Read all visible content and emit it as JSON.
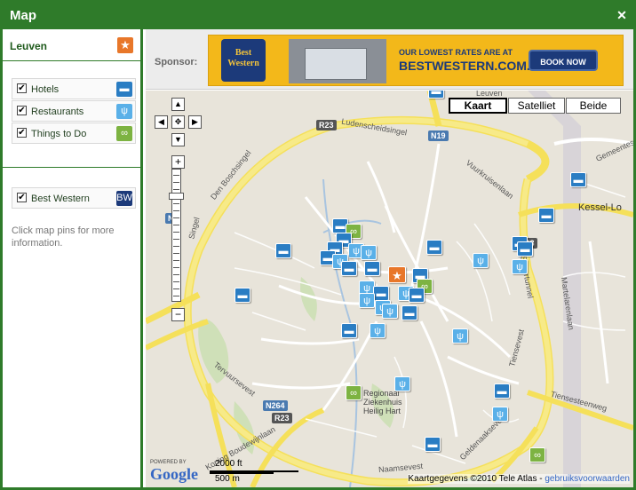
{
  "window": {
    "title": "Map",
    "close_symbol": "✕"
  },
  "sidebar": {
    "city": "Leuven",
    "filters": [
      {
        "label": "Hotels",
        "checked": "✔",
        "icon": "bed-icon",
        "color": "#2a7dc3"
      },
      {
        "label": "Restaurants",
        "checked": "✔",
        "icon": "fork-knife-icon",
        "color": "#5ab0e8"
      },
      {
        "label": "Things to Do",
        "checked": "✔",
        "icon": "binoculars-icon",
        "color": "#7db342"
      }
    ],
    "brand_filter": {
      "label": "Best Western",
      "checked": "✔",
      "icon": "best-western-logo-icon"
    },
    "hint": "Click map pins for more information."
  },
  "sponsor": {
    "label": "Sponsor:",
    "ad": {
      "logo_text": "Best Western",
      "headline": "OUR LOWEST RATES ARE AT",
      "domain": "BESTWESTERN.COM.",
      "button": "BOOK NOW"
    }
  },
  "map": {
    "map_types": [
      "Kaart",
      "Satelliet",
      "Beide"
    ],
    "active_map_type": "Kaart",
    "street_labels": {
      "leuven": "Leuven",
      "ludenscheid": "Ludenscheidsingel",
      "r23_top": "R23",
      "n19": "N19",
      "vuurkruisen": "Vuurkruisenlaan",
      "gemeente": "Gemeentest",
      "kessel": "Kessel-Lo",
      "bosch": "Den Boschsingel",
      "n_left": "N",
      "r23_right": "R23",
      "spoor": "Spoortunnel",
      "martel": "Martelarenlaan",
      "tervuur": "Tervuursevest",
      "tiensevest": "Tiensevest",
      "tiensesteen": "Tiensesteenweg",
      "regionaal": "Regionaal Ziekenhuis Heilig Hart",
      "n264": "N264",
      "r23_bottom": "R23",
      "koning": "Koning Boudewijnlaan",
      "geldenaak": "Geldenaaksevest",
      "naamse": "Naamsevest",
      "singel": "Singel"
    },
    "scale": {
      "imperial": "2000 ft",
      "metric": "500 m"
    },
    "powered_by": "POWERED BY",
    "google": "Google",
    "copyright": "Kaartgegevens ©2010 Tele Atlas -",
    "terms_link": "gebruiksvoorwaarden"
  }
}
